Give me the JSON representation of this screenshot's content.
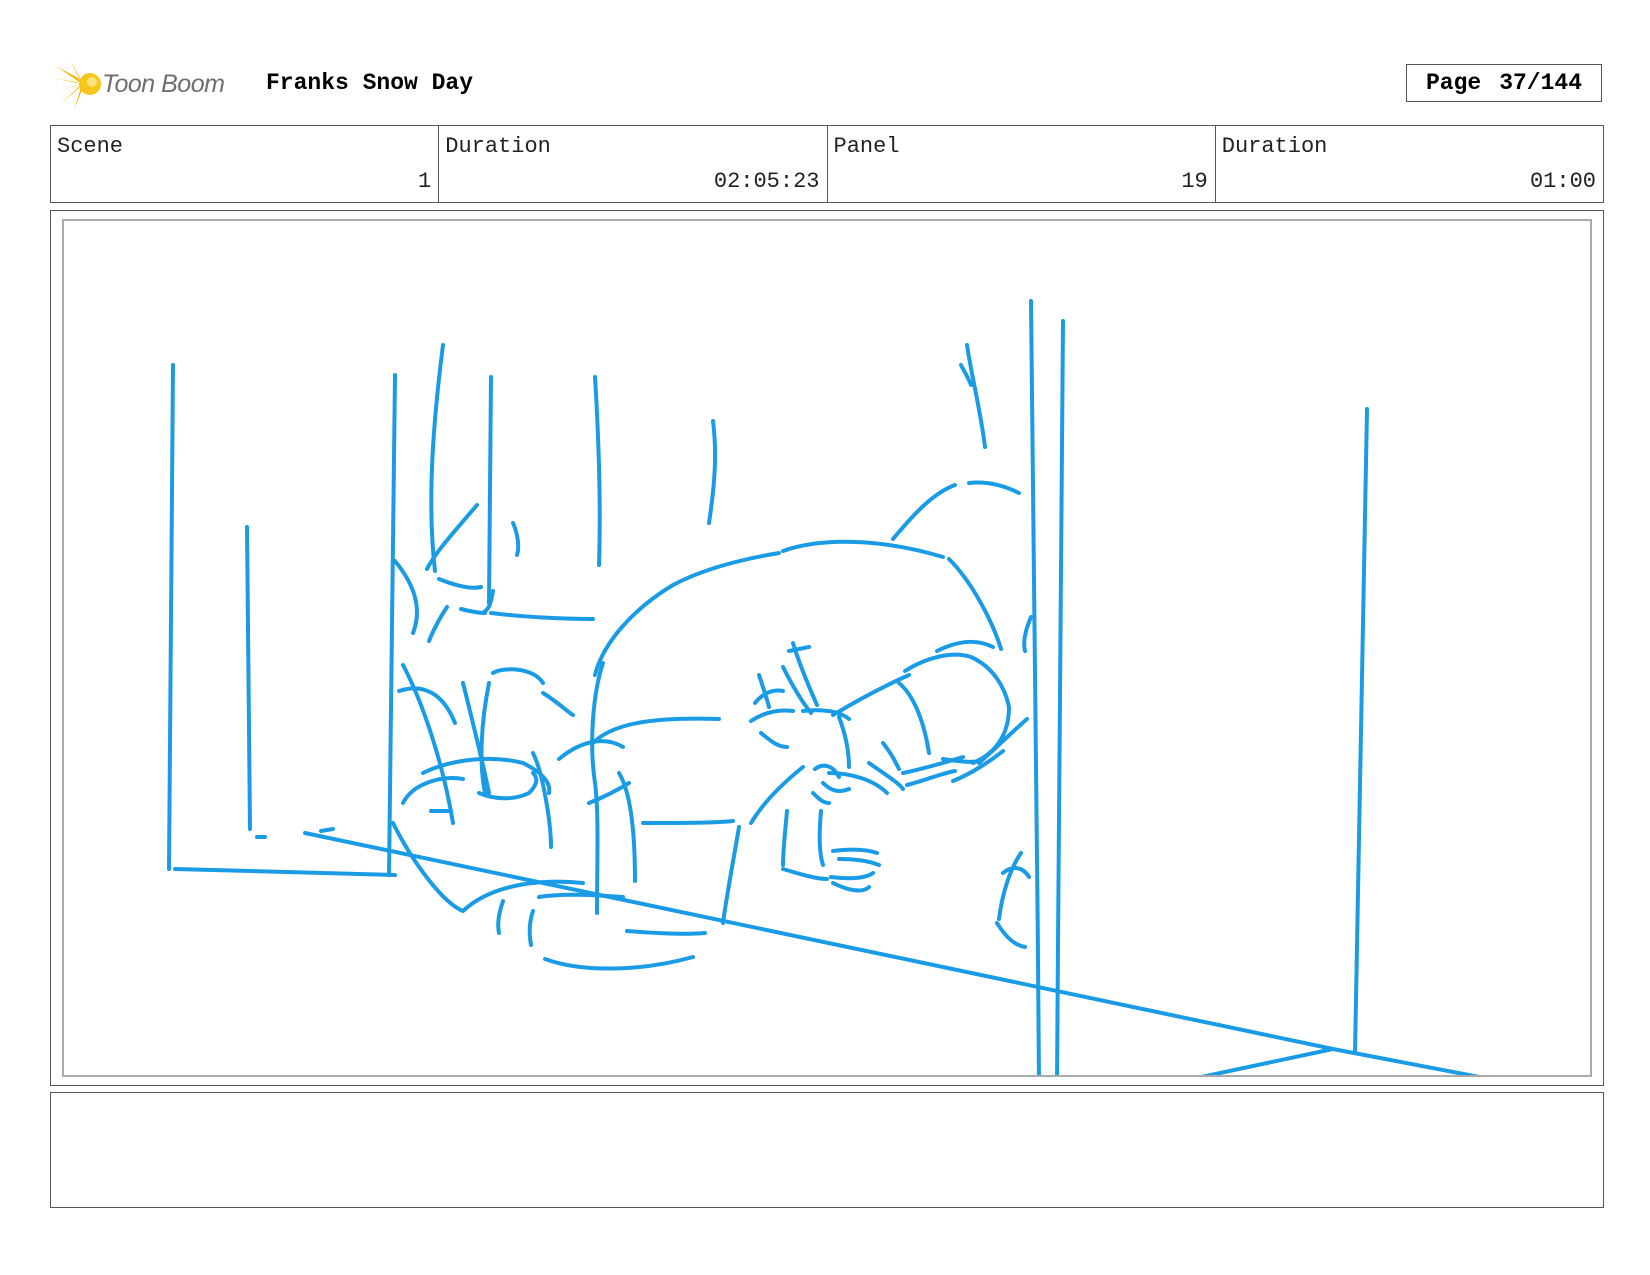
{
  "header": {
    "logo_text": "Toon Boom",
    "project_title": "Franks Snow Day",
    "page_label": "Page",
    "page_value": "37/144"
  },
  "info": {
    "scene_label": "Scene",
    "scene_value": "1",
    "scene_duration_label": "Duration",
    "scene_duration_value": "02:05:23",
    "panel_label": "Panel",
    "panel_value": "19",
    "panel_duration_label": "Duration",
    "panel_duration_value": "01:00"
  },
  "colors": {
    "sketch": "#1a9be6",
    "logo_accent": "#f5b800"
  }
}
